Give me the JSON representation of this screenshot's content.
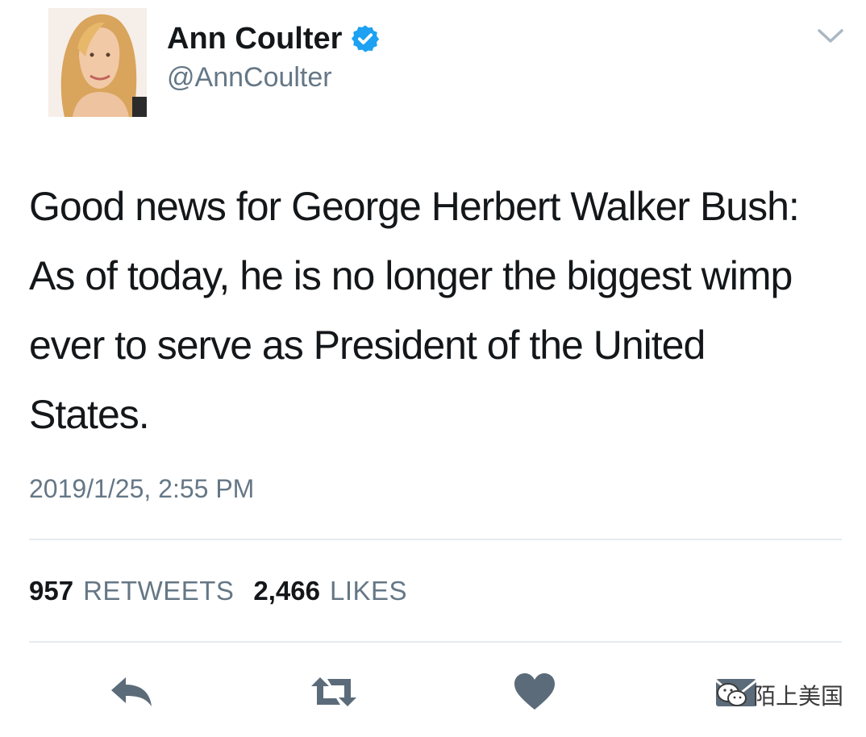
{
  "author": {
    "display_name": "Ann Coulter",
    "handle": "@AnnCoulter",
    "verified": true
  },
  "tweet": {
    "text": "Good news for George Herbert Walker Bush: As of today, he is no longer the biggest wimp ever to serve as President of the United States.",
    "timestamp": "2019/1/25, 2:55 PM"
  },
  "stats": {
    "retweets_count": "957",
    "retweets_label": "RETWEETS",
    "likes_count": "2,466",
    "likes_label": "LIKES"
  },
  "actions": {
    "icons": [
      "reply-icon",
      "retweet-icon",
      "like-icon",
      "message-icon"
    ]
  },
  "watermark": {
    "text": "陌上美国"
  },
  "colors": {
    "text_primary": "#14171a",
    "text_secondary": "#657786",
    "verified_blue": "#1da1f2",
    "action_icon": "#5b6b79",
    "divider": "#e6ecf0"
  }
}
